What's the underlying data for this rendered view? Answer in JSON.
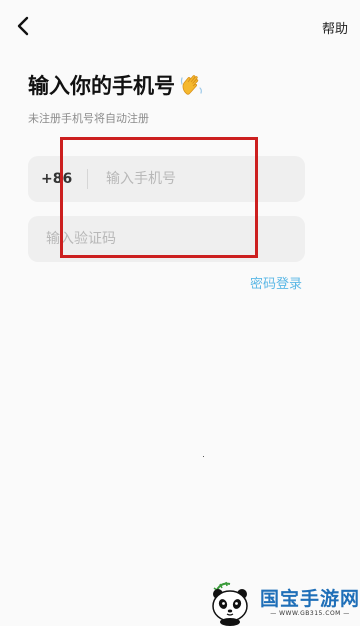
{
  "header": {
    "back_icon": "chevron-left-icon",
    "help_label": "帮助"
  },
  "title": "输入你的手机号",
  "title_emoji_icon": "waving-hand-icon",
  "subtitle": "未注册手机号将自动注册",
  "phone_field": {
    "country_code": "+86",
    "placeholder": "输入手机号",
    "value": ""
  },
  "code_field": {
    "placeholder": "输入验证码",
    "value": ""
  },
  "password_login_label": "密码登录",
  "watermark": {
    "icon": "panda-logo",
    "name": "国宝手游网",
    "url": "— WWW.GB315.COM —"
  },
  "colors": {
    "background": "#fafafa",
    "field_bg": "#efefef",
    "link": "#5cb8e6",
    "highlight": "#cc1f1f",
    "watermark": "#1f6fb8"
  }
}
